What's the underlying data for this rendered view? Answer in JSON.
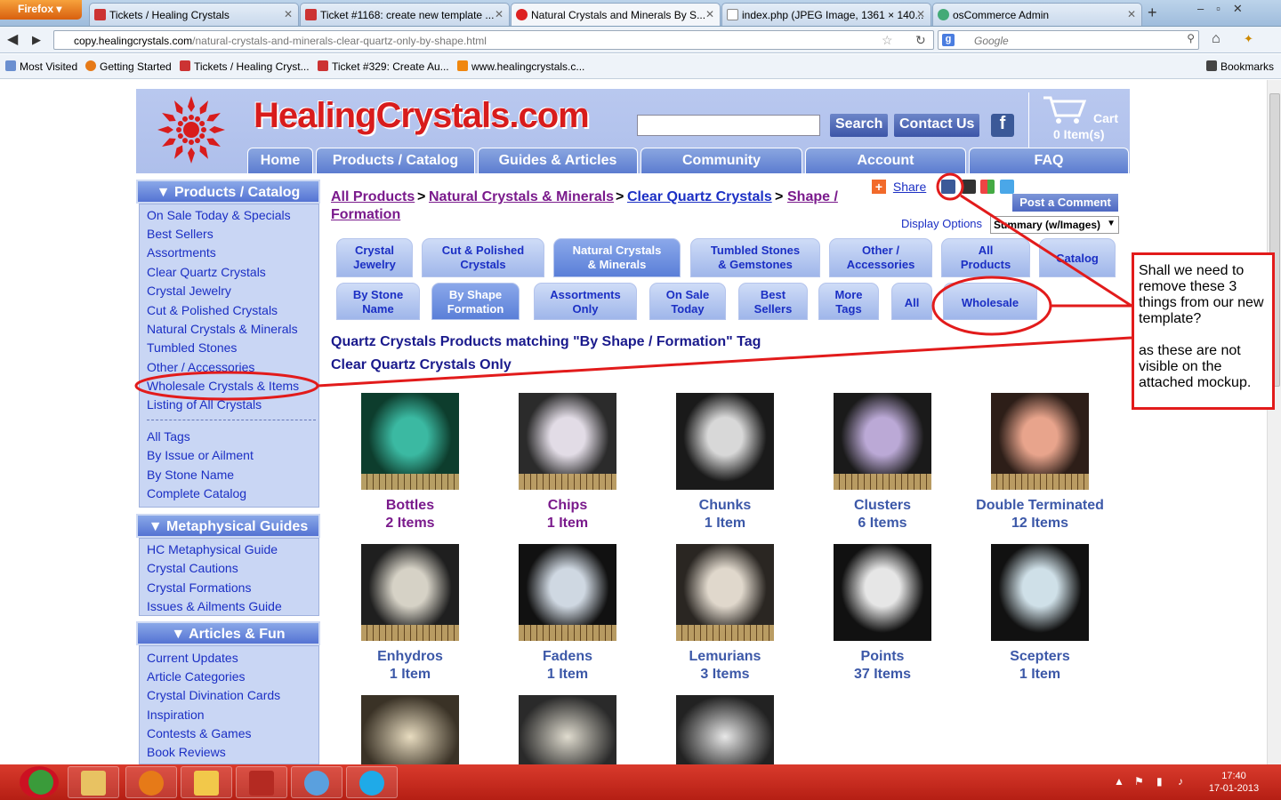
{
  "browser": {
    "menu_button": "Firefox",
    "tabs": [
      {
        "label": "Tickets / Healing Crystals",
        "icon": "oc-icon"
      },
      {
        "label": "Ticket #1168: create new template ...",
        "icon": "oc-icon"
      },
      {
        "label": "Natural Crystals and Minerals By S...",
        "icon": "hc-icon"
      },
      {
        "label": "index.php (JPEG Image, 1361 × 140...",
        "icon": "page-icon"
      },
      {
        "label": "osCommerce Admin",
        "icon": "oscommerce-icon"
      }
    ],
    "url_host": "copy.healingcrystals.com",
    "url_path": "/natural-crystals-and-minerals-clear-quartz-only-by-shape.html",
    "search_placeholder": "Google",
    "bookmarks": [
      "Most Visited",
      "Getting Started",
      "Tickets / Healing Cryst...",
      "Ticket #329: Create Au...",
      "www.healingcrystals.c..."
    ],
    "bookmarks_menu": "Bookmarks"
  },
  "site": {
    "logo_text": "HealingCrystals.com",
    "search_button": "Search",
    "contact_button": "Contact Us",
    "facebook_glyph": "f",
    "cart_label": "Cart",
    "cart_items": "0 Item(s)",
    "nav": [
      "Home",
      "Products / Catalog",
      "Guides & Articles",
      "Community",
      "Account",
      "FAQ"
    ]
  },
  "sidebar": {
    "products_title": "Products / Catalog",
    "products_links": [
      "On Sale Today & Specials",
      "Best Sellers",
      "Assortments",
      "Clear Quartz Crystals",
      "Crystal Jewelry",
      "Cut & Polished Crystals",
      "Natural Crystals & Minerals",
      "Tumbled Stones",
      "Other / Accessories",
      "Wholesale Crystals & Items",
      "Listing of All Crystals"
    ],
    "tags_links": [
      "All Tags",
      "By Issue or Ailment",
      "By Stone Name",
      "Complete Catalog"
    ],
    "meta_title": "Metaphysical Guides",
    "meta_links": [
      "HC Metaphysical Guide",
      "Crystal Cautions",
      "Crystal Formations",
      "Issues & Ailments Guide"
    ],
    "articles_title": "Articles & Fun",
    "articles_links": [
      "Current Updates",
      "Article Categories",
      "Crystal Divination Cards",
      "Inspiration",
      "Contests & Games",
      "Book Reviews"
    ]
  },
  "content": {
    "breadcrumb": [
      "All Products",
      "Natural Crystals & Minerals",
      "Clear Quartz Crystals",
      "Shape /",
      "Formation"
    ],
    "breadcrumb_sep": ">",
    "share": "Share",
    "post_comment": "Post a Comment",
    "display_options": "Display Options",
    "display_select": "Summary (w/Images)",
    "cat_tabs": [
      {
        "l1": "Crystal",
        "l2": "Jewelry"
      },
      {
        "l1": "Cut & Polished",
        "l2": "Crystals"
      },
      {
        "l1": "Natural Crystals",
        "l2": "& Minerals"
      },
      {
        "l1": "Tumbled Stones",
        "l2": "& Gemstones"
      },
      {
        "l1": "Other /",
        "l2": "Accessories"
      },
      {
        "l1": "All",
        "l2": "Products"
      },
      {
        "l1": "Catalog",
        "l2": ""
      }
    ],
    "sub_tabs": [
      {
        "l1": "By Stone",
        "l2": "Name"
      },
      {
        "l1": "By Shape",
        "l2": "Formation"
      },
      {
        "l1": "Assortments",
        "l2": "Only"
      },
      {
        "l1": "On Sale",
        "l2": "Today"
      },
      {
        "l1": "Best",
        "l2": "Sellers"
      },
      {
        "l1": "More",
        "l2": "Tags"
      },
      {
        "l1": "All",
        "l2": ""
      },
      {
        "l1": "Wholesale",
        "l2": ""
      }
    ],
    "heading1": "Quartz Crystals Products matching \"By Shape / Formation\" Tag",
    "heading2": "Clear Quartz Crystals Only",
    "products": [
      {
        "name": "Bottles",
        "count": "2 Items"
      },
      {
        "name": "Chips",
        "count": "1 Item"
      },
      {
        "name": "Chunks",
        "count": "1 Item"
      },
      {
        "name": "Clusters",
        "count": "6 Items"
      },
      {
        "name": "Double Terminated",
        "count": "12 Items"
      },
      {
        "name": "Enhydros",
        "count": "1 Item"
      },
      {
        "name": "Fadens",
        "count": "1 Item"
      },
      {
        "name": "Lemurians",
        "count": "3 Items"
      },
      {
        "name": "Points",
        "count": "37 Items"
      },
      {
        "name": "Scepters",
        "count": "1 Item"
      }
    ],
    "annotation": [
      "Shall we need to remove these 3 things from our new template?",
      "as these are not visible on the attached mockup."
    ]
  },
  "taskbar": {
    "time": "17:40",
    "date": "17-01-2013",
    "apps": [
      "chrome-icon",
      "explorer-icon",
      "firefox-icon",
      "mail-icon",
      "filezilla-icon",
      "gtalk-icon",
      "skype-icon"
    ]
  },
  "colors": {
    "visited_link": "#7a1a8c",
    "link": "#1b2fc4",
    "annotation_red": "#e21b1b"
  }
}
